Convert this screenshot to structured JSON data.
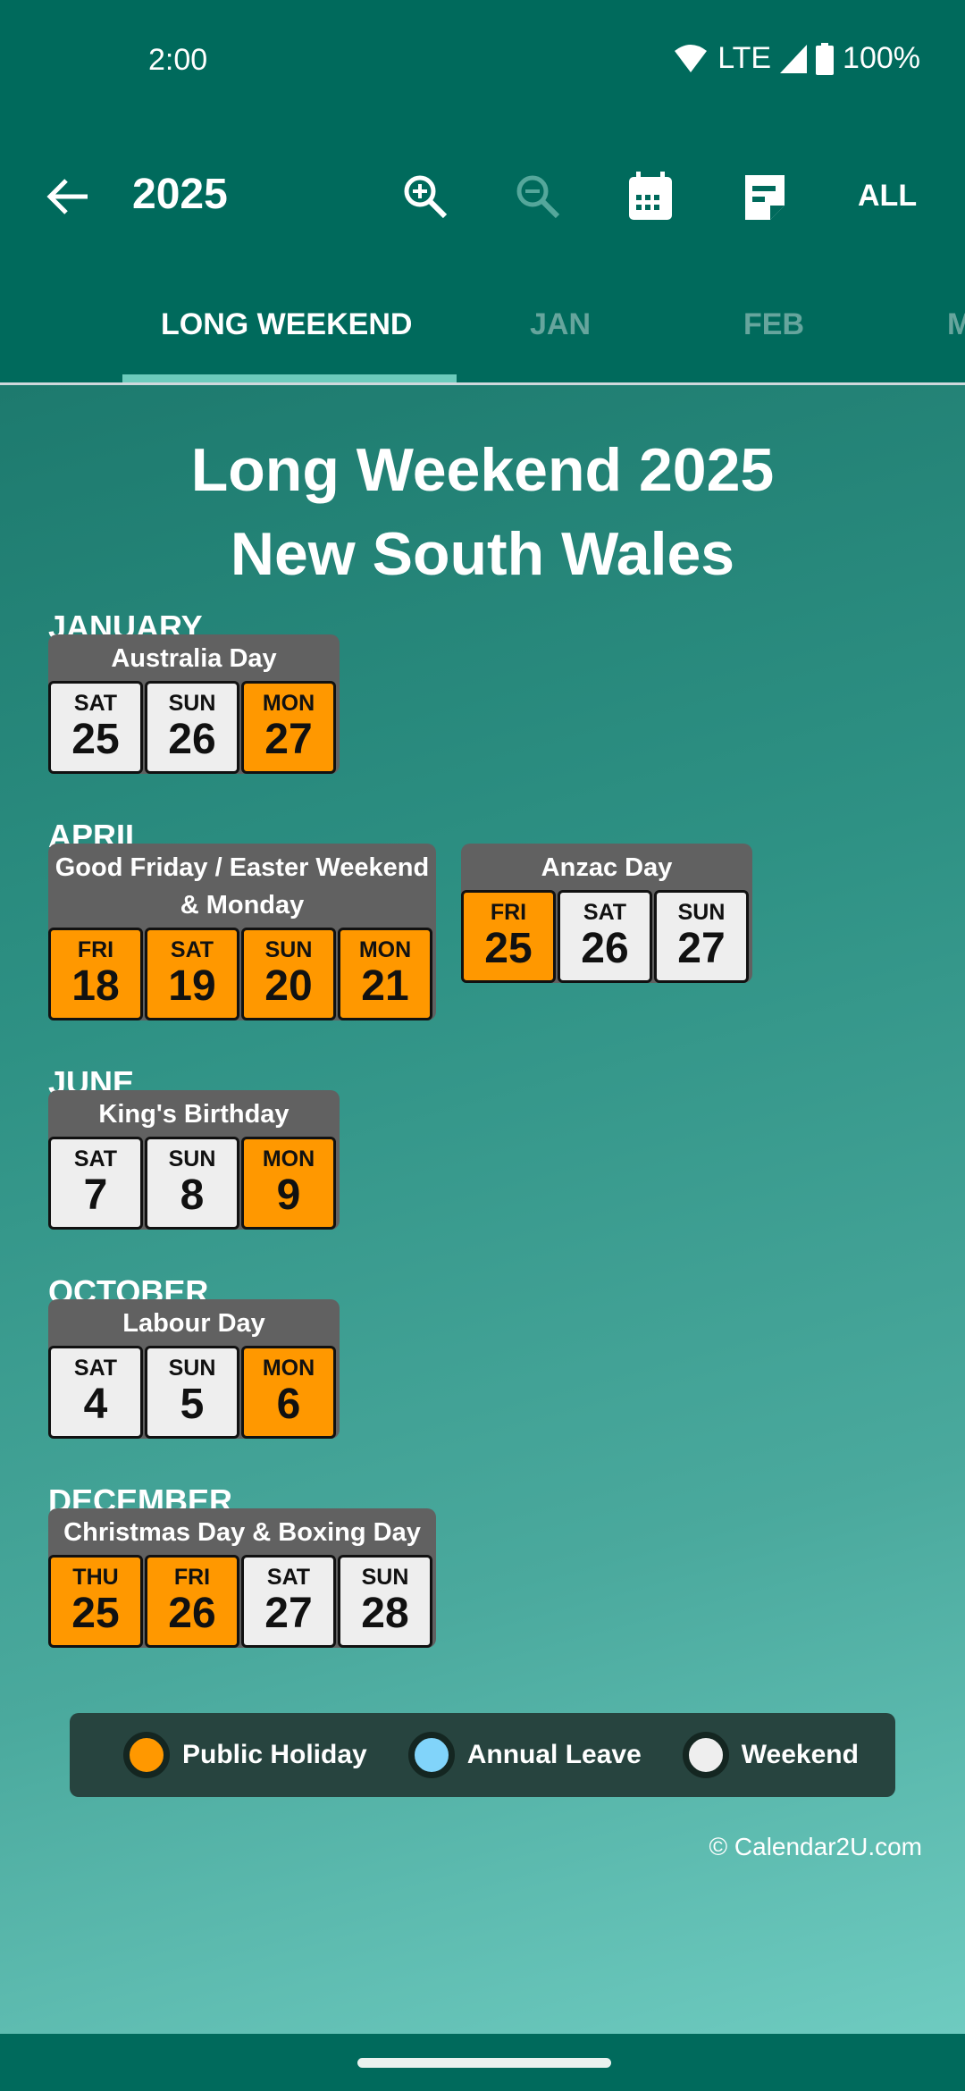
{
  "status_bar": {
    "time": "2:00",
    "network": "LTE",
    "battery": "100%"
  },
  "app_bar": {
    "title": "2025",
    "all_label": "ALL",
    "icons": [
      "back-arrow-icon",
      "zoom-in-icon",
      "zoom-out-icon",
      "calendar-icon",
      "note-icon"
    ]
  },
  "tabs": [
    {
      "label": "LONG WEEKEND",
      "active": true
    },
    {
      "label": "JAN",
      "active": false
    },
    {
      "label": "FEB",
      "active": false
    },
    {
      "label": "M",
      "active": false
    }
  ],
  "heading": {
    "line1": "Long Weekend 2025",
    "line2": "New South Wales"
  },
  "months": [
    {
      "name": "JANUARY",
      "events": [
        {
          "title": "Australia Day",
          "days": [
            {
              "dow": "SAT",
              "num": "25",
              "type": "weekend"
            },
            {
              "dow": "SUN",
              "num": "26",
              "type": "weekend"
            },
            {
              "dow": "MON",
              "num": "27",
              "type": "holiday"
            }
          ]
        }
      ]
    },
    {
      "name": "APRIL",
      "events": [
        {
          "title": "Good Friday / Easter Weekend & Monday",
          "days": [
            {
              "dow": "FRI",
              "num": "18",
              "type": "holiday"
            },
            {
              "dow": "SAT",
              "num": "19",
              "type": "holiday"
            },
            {
              "dow": "SUN",
              "num": "20",
              "type": "holiday"
            },
            {
              "dow": "MON",
              "num": "21",
              "type": "holiday"
            }
          ]
        },
        {
          "title": "Anzac Day",
          "days": [
            {
              "dow": "FRI",
              "num": "25",
              "type": "holiday"
            },
            {
              "dow": "SAT",
              "num": "26",
              "type": "weekend"
            },
            {
              "dow": "SUN",
              "num": "27",
              "type": "weekend"
            }
          ]
        }
      ]
    },
    {
      "name": "JUNE",
      "events": [
        {
          "title": "King's Birthday",
          "days": [
            {
              "dow": "SAT",
              "num": "7",
              "type": "weekend"
            },
            {
              "dow": "SUN",
              "num": "8",
              "type": "weekend"
            },
            {
              "dow": "MON",
              "num": "9",
              "type": "holiday"
            }
          ]
        }
      ]
    },
    {
      "name": "OCTOBER",
      "events": [
        {
          "title": "Labour Day",
          "days": [
            {
              "dow": "SAT",
              "num": "4",
              "type": "weekend"
            },
            {
              "dow": "SUN",
              "num": "5",
              "type": "weekend"
            },
            {
              "dow": "MON",
              "num": "6",
              "type": "holiday"
            }
          ]
        }
      ]
    },
    {
      "name": "DECEMBER",
      "events": [
        {
          "title": "Christmas Day & Boxing Day",
          "days": [
            {
              "dow": "THU",
              "num": "25",
              "type": "holiday"
            },
            {
              "dow": "FRI",
              "num": "26",
              "type": "holiday"
            },
            {
              "dow": "SAT",
              "num": "27",
              "type": "weekend"
            },
            {
              "dow": "SUN",
              "num": "28",
              "type": "weekend"
            }
          ]
        }
      ]
    }
  ],
  "legend": [
    {
      "label": "Public Holiday",
      "color": "#ff9800"
    },
    {
      "label": "Annual Leave",
      "color": "#81d4fa"
    },
    {
      "label": "Weekend",
      "color": "#eeeeee"
    }
  ],
  "copyright": "© Calendar2U.com"
}
